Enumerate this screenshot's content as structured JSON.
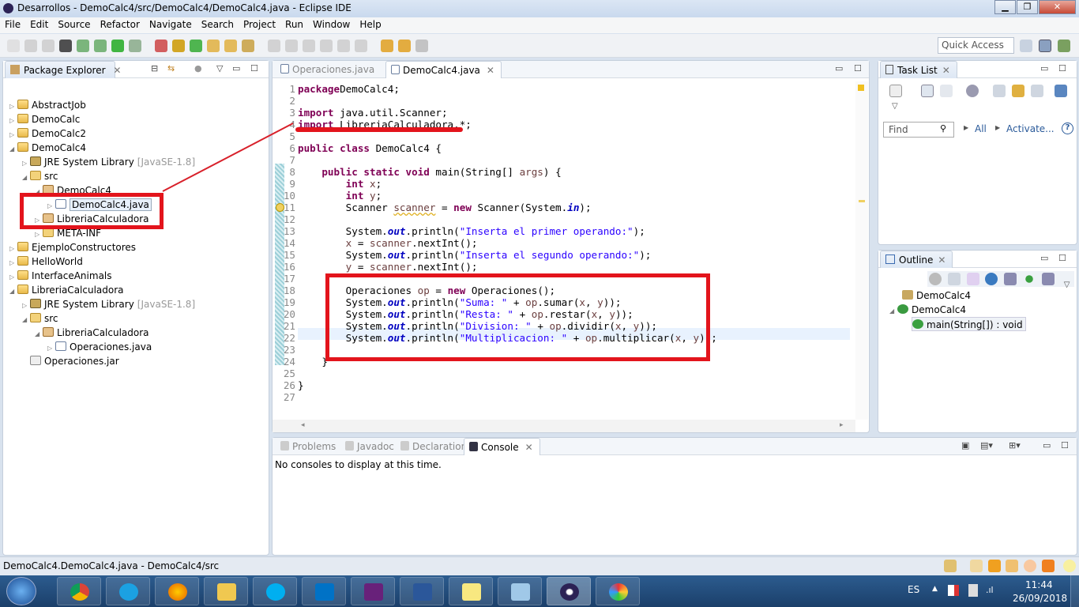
{
  "window": {
    "title": "Desarrollos - DemoCalc4/src/DemoCalc4/DemoCalc4.java - Eclipse IDE",
    "minimize": "▁",
    "restore": "❐",
    "close": "✕"
  },
  "menu": [
    "File",
    "Edit",
    "Source",
    "Refactor",
    "Navigate",
    "Search",
    "Project",
    "Run",
    "Window",
    "Help"
  ],
  "toolbar": {
    "quick_access": "Quick Access"
  },
  "package_explorer": {
    "title": "Package Explorer",
    "items": [
      {
        "label": "AbstractJob",
        "level": 0,
        "icon": "project-icon",
        "expanded": false
      },
      {
        "label": "DemoCalc",
        "level": 0,
        "icon": "project-icon",
        "expanded": false
      },
      {
        "label": "DemoCalc2",
        "level": 0,
        "icon": "project-icon",
        "expanded": false
      },
      {
        "label": "DemoCalc4",
        "level": 0,
        "icon": "project-icon",
        "expanded": true
      },
      {
        "label": "JRE System Library",
        "suffix": "[JavaSE-1.8]",
        "level": 1,
        "icon": "library-icon",
        "expanded": false
      },
      {
        "label": "src",
        "level": 1,
        "icon": "source-folder-icon",
        "expanded": true
      },
      {
        "label": "DemoCalc4",
        "level": 2,
        "icon": "package-icon",
        "expanded": true
      },
      {
        "label": "DemoCalc4.java",
        "level": 3,
        "icon": "java-file-icon",
        "expanded": false,
        "selected": true
      },
      {
        "label": "LibreriaCalculadora",
        "level": 2,
        "icon": "package-icon",
        "expanded": false
      },
      {
        "label": "META-INF",
        "level": 2,
        "icon": "folder-icon",
        "expanded": false
      },
      {
        "label": "EjemploConstructores",
        "level": 0,
        "icon": "project-icon",
        "expanded": false
      },
      {
        "label": "HelloWorld",
        "level": 0,
        "icon": "project-icon",
        "expanded": false
      },
      {
        "label": "InterfaceAnimals",
        "level": 0,
        "icon": "project-icon",
        "expanded": false
      },
      {
        "label": "LibreriaCalculadora",
        "level": 0,
        "icon": "project-icon",
        "expanded": true
      },
      {
        "label": "JRE System Library",
        "suffix": "[JavaSE-1.8]",
        "level": 1,
        "icon": "library-icon",
        "expanded": false
      },
      {
        "label": "src",
        "level": 1,
        "icon": "source-folder-icon",
        "expanded": true
      },
      {
        "label": "LibreriaCalculadora",
        "level": 2,
        "icon": "package-icon",
        "expanded": true
      },
      {
        "label": "Operaciones.java",
        "level": 3,
        "icon": "java-file-icon",
        "expanded": false
      },
      {
        "label": "Operaciones.jar",
        "level": 1,
        "icon": "jar-icon",
        "leaf": true
      }
    ]
  },
  "editor": {
    "tabs": [
      {
        "label": "Operaciones.java",
        "active": false
      },
      {
        "label": "DemoCalc4.java",
        "active": true
      }
    ],
    "lines": [
      [
        [
          "kw",
          "package"
        ],
        [
          "",
          "DemoCalc4;"
        ]
      ],
      [],
      [
        [
          "kw",
          "import"
        ],
        [
          "",
          " java.util.Scanner;"
        ]
      ],
      [
        [
          "kw",
          "import"
        ],
        [
          "",
          " LibreriaCalculadora.*;"
        ]
      ],
      [],
      [
        [
          "kw",
          "public class"
        ],
        [
          "",
          " DemoCalc4 {"
        ]
      ],
      [],
      [
        [
          "",
          "    "
        ],
        [
          "kw",
          "public static void"
        ],
        [
          "",
          " main(String[] "
        ],
        [
          "var",
          "args"
        ],
        [
          "",
          ") {"
        ]
      ],
      [
        [
          "",
          "        "
        ],
        [
          "kw",
          "int"
        ],
        [
          "var",
          " x"
        ],
        [
          "",
          ";"
        ]
      ],
      [
        [
          "",
          "        "
        ],
        [
          "kw",
          "int"
        ],
        [
          "var",
          " y"
        ],
        [
          "",
          ";"
        ]
      ],
      [
        [
          "",
          "        Scanner "
        ],
        [
          "var",
          "scanner"
        ],
        [
          "",
          " = "
        ],
        [
          "kw",
          "new"
        ],
        [
          "",
          " Scanner(System."
        ],
        [
          "fld",
          "in"
        ],
        [
          "",
          ");"
        ]
      ],
      [],
      [
        [
          "",
          "        System."
        ],
        [
          "fld",
          "out"
        ],
        [
          "",
          ".println("
        ],
        [
          "str",
          "\"Inserta el primer operando:\""
        ],
        [
          "",
          ");"
        ]
      ],
      [
        [
          "var",
          "        x"
        ],
        [
          "",
          " = "
        ],
        [
          "var",
          "scanner"
        ],
        [
          "",
          ".nextInt();"
        ]
      ],
      [
        [
          "",
          "        System."
        ],
        [
          "fld",
          "out"
        ],
        [
          "",
          ".println("
        ],
        [
          "str",
          "\"Inserta el segundo operando:\""
        ],
        [
          "",
          ");"
        ]
      ],
      [
        [
          "var",
          "        y"
        ],
        [
          "",
          " = "
        ],
        [
          "var",
          "scanner"
        ],
        [
          "",
          ".nextInt();"
        ]
      ],
      [],
      [
        [
          "",
          "        Operaciones "
        ],
        [
          "var",
          "op"
        ],
        [
          "",
          " = "
        ],
        [
          "kw",
          "new"
        ],
        [
          "",
          " Operaciones();"
        ]
      ],
      [
        [
          "",
          "        System."
        ],
        [
          "fld",
          "out"
        ],
        [
          "",
          ".println("
        ],
        [
          "str",
          "\"Suma: \""
        ],
        [
          "",
          " + "
        ],
        [
          "var",
          "op"
        ],
        [
          "",
          ".sumar("
        ],
        [
          "var",
          "x"
        ],
        [
          ", ",
          ", "
        ],
        [
          "var",
          "y"
        ],
        [
          "",
          "));"
        ]
      ],
      [
        [
          "",
          "        System."
        ],
        [
          "fld",
          "out"
        ],
        [
          "",
          ".println("
        ],
        [
          "str",
          "\"Resta: \""
        ],
        [
          "",
          " + "
        ],
        [
          "var",
          "op"
        ],
        [
          "",
          ".restar("
        ],
        [
          "var",
          "x"
        ],
        [
          "",
          ", "
        ],
        [
          "var",
          "y"
        ],
        [
          "",
          "));"
        ]
      ],
      [
        [
          "",
          "        System."
        ],
        [
          "fld",
          "out"
        ],
        [
          "",
          ".println("
        ],
        [
          "str",
          "\"Division: \""
        ],
        [
          "",
          " + "
        ],
        [
          "var",
          "op"
        ],
        [
          "",
          ".dividir("
        ],
        [
          "var",
          "x"
        ],
        [
          "",
          ", "
        ],
        [
          "var",
          "y"
        ],
        [
          "",
          "));"
        ]
      ],
      [
        [
          "",
          "        System."
        ],
        [
          "fld",
          "out"
        ],
        [
          "",
          ".println("
        ],
        [
          "str",
          "\"Multiplicacion: \""
        ],
        [
          "",
          " + "
        ],
        [
          "var",
          "op"
        ],
        [
          "",
          ".multiplicar("
        ],
        [
          "var",
          "x"
        ],
        [
          "",
          ", "
        ],
        [
          "var",
          "y"
        ],
        [
          "",
          "));"
        ]
      ],
      [],
      [
        [
          "",
          "    }"
        ]
      ],
      [],
      [
        [
          "",
          "}"
        ]
      ],
      []
    ]
  },
  "task_list": {
    "title": "Task List",
    "find_placeholder": "Find",
    "all": "All",
    "activate": "Activate...",
    "help": "?"
  },
  "outline": {
    "title": "Outline",
    "items": [
      {
        "label": "DemoCalc4",
        "icon": "package-icon"
      },
      {
        "label": "DemoCalc4",
        "icon": "class-icon"
      },
      {
        "label": "main(String[]) : void",
        "icon": "method-icon"
      }
    ]
  },
  "bottom": {
    "tabs": [
      "Problems",
      "Javadoc",
      "Declaration",
      "Console"
    ],
    "active": "Console",
    "message": "No consoles to display at this time."
  },
  "status": {
    "text": "DemoCalc4.DemoCalc4.java - DemoCalc4/src"
  },
  "taskbar": {
    "apps": [
      "chrome",
      "internet-explorer",
      "firefox",
      "file-explorer",
      "skype",
      "outlook",
      "visual-studio",
      "word",
      "sticky-notes",
      "notepad",
      "eclipse",
      "paint"
    ],
    "lang": "ES",
    "time": "11:44",
    "date": "26/09/2018"
  },
  "colors": {
    "annotation": "#e3141c",
    "keyword": "#7f0055",
    "string": "#2a00ff"
  }
}
